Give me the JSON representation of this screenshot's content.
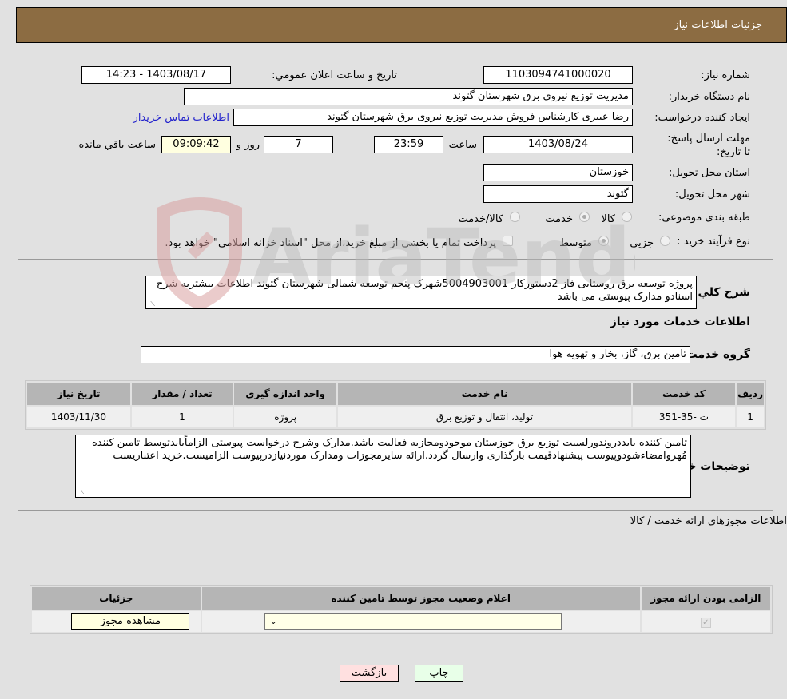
{
  "header": {
    "title": "جزئیات اطلاعات نیاز"
  },
  "details": {
    "need_number_label": "شماره نیاز:",
    "need_number": "1103094741000020",
    "announce_label": "تاریخ و ساعت اعلان عمومي:",
    "announce_value": "1403/08/17 - 14:23",
    "buyer_org_label": "نام دستگاه خريدار:",
    "buyer_org": "مدیریت توزیع نیروی برق شهرستان گتوند",
    "creator_label": "ایجاد کننده درخواست:",
    "creator": "رضا عبیری کارشناس فروش مدیریت توزیع نیروی برق شهرستان گتوند",
    "contact_link": "اطلاعات تماس خریدار",
    "deadline_label": "مهلت ارسال پاسخ: تا تاریخ:",
    "deadline_date": "1403/08/24",
    "time_label": "ساعت",
    "deadline_time": "23:59",
    "days": "7",
    "days_label": "روز و",
    "remaining_time": "09:09:42",
    "remaining_label": "ساعت باقي مانده",
    "province_label": "استان محل تحویل:",
    "province": "خوزستان",
    "city_label": "شهر محل تحویل:",
    "city": "گتوند",
    "category_label": "طبقه بندی موضوعی:",
    "category_options": [
      {
        "label": "کالا",
        "checked": false
      },
      {
        "label": "خدمت",
        "checked": true
      },
      {
        "label": "کالا/خدمت",
        "checked": false
      }
    ],
    "process_label": "نوع فرآیند خرید :",
    "process_options": [
      {
        "label": "جزيي",
        "checked": false
      },
      {
        "label": "متوسط",
        "checked": true
      }
    ],
    "treasury_note": "پرداخت تمام یا بخشی از مبلغ خرید،از محل \"اسناد خزانه اسلامی\" خواهد بود."
  },
  "summary": {
    "label": "شرح كلي نياز:",
    "text": "پروژه توسعه برق روستایی فاز 2دستورکار 5004903001شهرک پنجم توسعه شمالی شهرستان گتوند اطلاعات بیشتربه شرح اسنادو مدارک پیوستی می باشد",
    "services_heading": "اطلاعات خدمات مورد نیاز",
    "service_group_label": "گروه خدمت:",
    "service_group": "تامین برق، گاز، بخار و تهویه هوا"
  },
  "services_table": {
    "headers": [
      "ردیف",
      "کد خدمت",
      "نام خدمت",
      "واحد اندازه گیری",
      "تعداد / مقدار",
      "تاریخ نیاز"
    ],
    "rows": [
      [
        "1",
        "ت -35-351",
        "تولید، انتقال و توزیع برق",
        "پروژه",
        "1",
        "1403/11/30"
      ]
    ]
  },
  "buyer_notes": {
    "label": "توضیحات خریدار:",
    "text": "تامین کننده بایددروندورلسیت توزیع برق خوزستان موجودومجازبه فعالیت باشد.مدارک وشرح درخواست پیوستی الزاماًبایدتوسط تامین کننده مُهروامضاءشودوپیوست پیشنهادقیمت بارگذاری وارسال گردد.ارائه سایرمجوزات ومدارک موردنیازدرپیوست الزامیست.خرید اعتباریست"
  },
  "permits": {
    "heading": "اطلاعات مجوزهای ارائه خدمت / کالا",
    "headers": [
      "الزامی بودن ارائه مجوز",
      "اعلام وضعیت مجوز توسط تامین کننده",
      "جزئیات"
    ],
    "row": {
      "required_checked": true,
      "status_value": "--",
      "details_button": "مشاهده مجوز"
    }
  },
  "actions": {
    "print": "چاپ",
    "back": "بازگشت"
  },
  "watermark": {
    "text": "AriaTender.neT"
  }
}
